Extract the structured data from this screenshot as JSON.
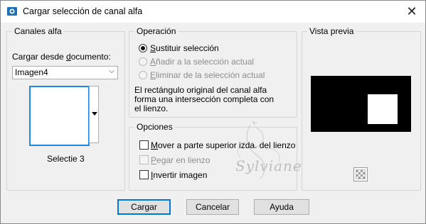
{
  "window": {
    "title": "Cargar selección de canal alfa",
    "close": "✕"
  },
  "channels": {
    "legend": "Canales alfa",
    "load_from_label": "Cargar desde documento:",
    "document_select": "Imagen4",
    "thumbnail_caption": "Selectie 3"
  },
  "operation": {
    "legend": "Operación",
    "options": [
      {
        "label": "Sustituir selección",
        "selected": true,
        "disabled": false
      },
      {
        "label": "Añadir a la selección actual",
        "selected": false,
        "disabled": true
      },
      {
        "label": "Eliminar de la selección actual",
        "selected": false,
        "disabled": true
      }
    ],
    "info_lines": [
      "El rectángulo original del canal alfa",
      "forma una intersección completa con",
      "el lienzo."
    ]
  },
  "options": {
    "legend": "Opciones",
    "checkboxes": [
      {
        "label": "Mover a parte superior izda. del lienzo",
        "checked": false,
        "disabled": false
      },
      {
        "label": "Pegar en lienzo",
        "checked": false,
        "disabled": true
      },
      {
        "label": "Invertir imagen",
        "checked": false,
        "disabled": false
      }
    ]
  },
  "preview": {
    "legend": "Vista previa"
  },
  "buttons": {
    "ok": "Cargar",
    "cancel": "Cancelar",
    "help": "Ayuda"
  },
  "watermark": {
    "text": "Sylviane"
  },
  "colors": {
    "accent": "#0078d7",
    "thumb_border": "#1e88e5",
    "preview_bg": "#000000",
    "selection": "#ffffff"
  },
  "icons": {
    "app": "channel-app-icon",
    "close": "close-icon",
    "dropdown": "chevron-down-icon",
    "checker": "transparency-checker-icon"
  }
}
